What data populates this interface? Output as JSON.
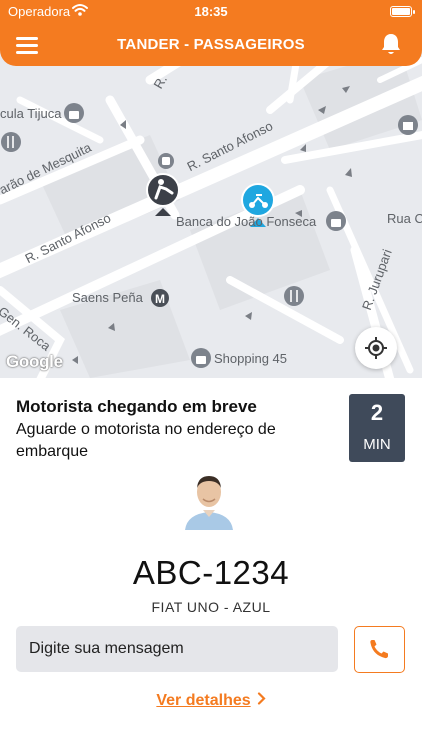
{
  "status_bar": {
    "carrier": "Operadora",
    "time": "18:35"
  },
  "header": {
    "title": "TANDER - PASSAGEIROS"
  },
  "map": {
    "labels": {
      "cula_tijuca": "cula Tijuca",
      "barao_de_mesquita": "arão de Mesquita",
      "r_santo_afonso_top": "R. Santo Afonso",
      "r_santo_afonso_left": "R. Santo Afonso",
      "banca": "Banca do João Fonseca",
      "rua_c": "Rua C",
      "r_jurupari": "R. Jurupari",
      "saens_pena": "Saens Peña",
      "gen_roca": "Gen. Roca",
      "shopping": "Shopping 45",
      "r_top": "R."
    },
    "logo": "Google"
  },
  "ride": {
    "title": "Motorista chegando em breve",
    "subtitle": "Aguarde o motorista no endereço de embarque",
    "eta_value": "2",
    "eta_unit": "MIN",
    "plate": "ABC-1234",
    "car_model": "FIAT UNO - AZUL"
  },
  "message": {
    "placeholder": "Digite sua mensagem"
  },
  "details": {
    "label": "Ver detalhes"
  },
  "colors": {
    "accent": "#f47b20",
    "eta_bg": "#3f4a5a",
    "map_bg": "#e8eaee",
    "driver_pin": "#1fa7e0",
    "passenger_pin": "#3c4048"
  },
  "icons": {
    "menu": "menu-icon",
    "bell": "bell-icon",
    "locate": "my-location-icon",
    "phone": "phone-icon",
    "chevron": "chevron-right-icon"
  }
}
